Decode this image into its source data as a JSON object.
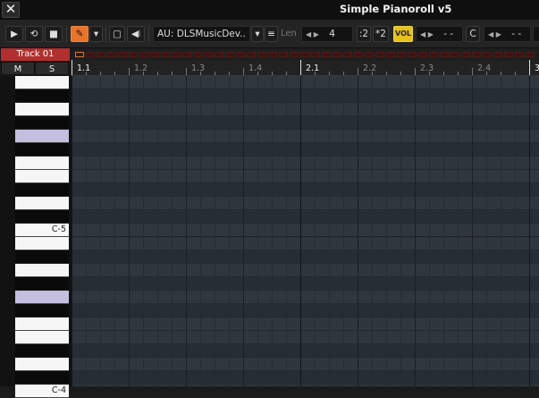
{
  "window": {
    "title": "Simple Pianoroll v5",
    "close_label": "✕"
  },
  "toolbar": {
    "play_label": "▶",
    "loop_label": "⟲",
    "stop_label": "■",
    "pencil_label": "✎",
    "dropdown_label": "▾",
    "select_label": "▢",
    "speaker_label": "◀⧘",
    "instrument": {
      "value": "AU: DLSMusicDev..",
      "arrow": "▾",
      "menu_label": "≡"
    },
    "len": {
      "label": "Len",
      "arrows": "◀ ▶",
      "value": "4"
    },
    "div2_label": ":2",
    "mul2_label": "*2",
    "vol_label": "VOL",
    "arrows1": "◀ ▶",
    "value1": "- -",
    "key_label": "C",
    "arrows2": "◀ ▶",
    "value2": "- -"
  },
  "track": {
    "name": "Track 01",
    "mute_label": "M",
    "solo_label": "S"
  },
  "ruler": {
    "labels": [
      "1.1",
      "1.2",
      "1.3",
      "1.4",
      "2.1",
      "2.2",
      "2.3",
      "2.4",
      "3"
    ]
  },
  "keyboard": {
    "labels": {
      "c5": "C-5",
      "c4": "C-4"
    }
  },
  "colors": {
    "track": "#b12f2f",
    "accent": "#e8732a",
    "vol": "#e6c21e",
    "highlight_key": "#c4bedf"
  }
}
